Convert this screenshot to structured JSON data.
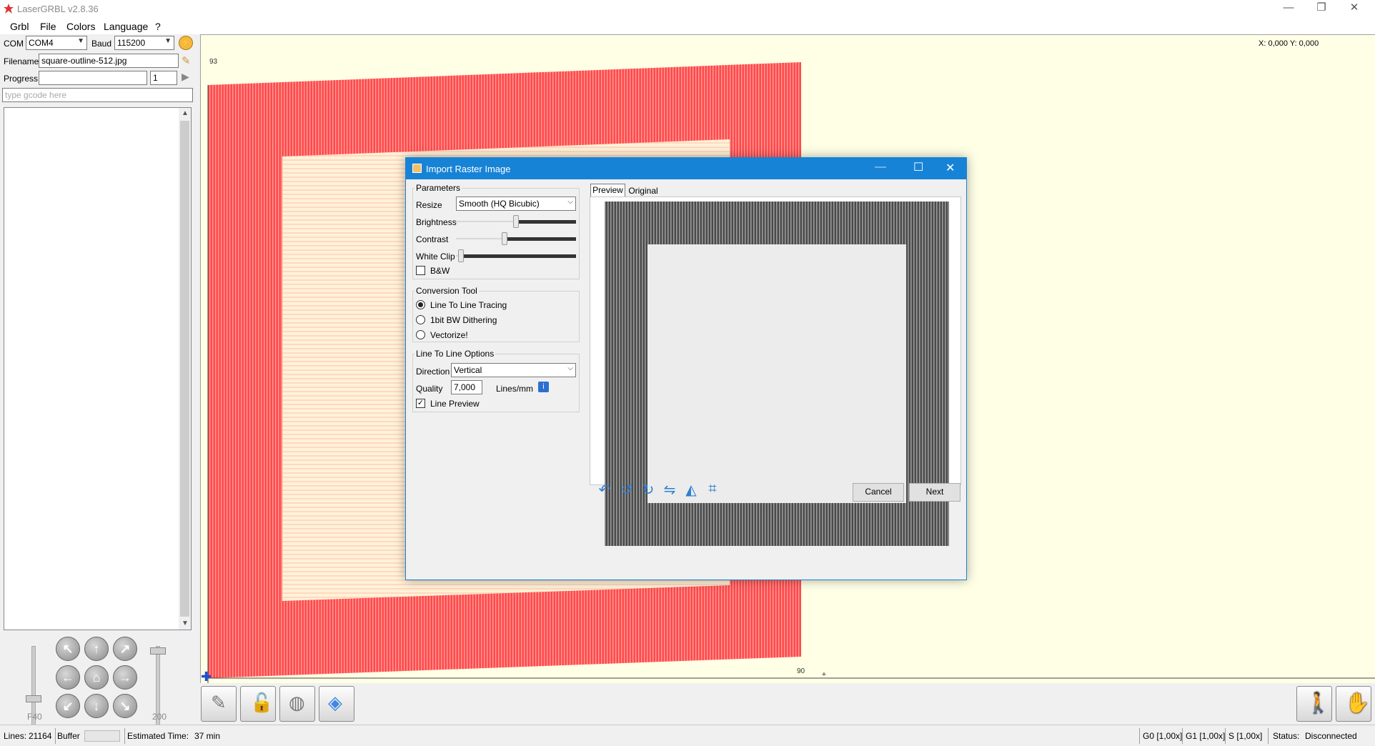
{
  "window": {
    "title": "LaserGRBL v2.8.36",
    "minimize": "—",
    "restore": "❐",
    "close": "✕"
  },
  "menu": [
    "Grbl",
    "File",
    "Colors",
    "Language",
    "?"
  ],
  "connection": {
    "com_label": "COM",
    "com_value": "COM4",
    "baud_label": "Baud",
    "baud_value": "115200"
  },
  "file": {
    "filename_label": "Filename",
    "filename_value": "square-outline-512.jpg"
  },
  "progress": {
    "label": "Progress",
    "count": "1",
    "fraction": 0
  },
  "gcode": {
    "placeholder": "type gcode here"
  },
  "jog": {
    "f_label": "F40",
    "step_label": "200"
  },
  "canvas": {
    "coords": "X: 0,000 Y: 0,000",
    "y_tick": "93",
    "x_tick": "90"
  },
  "status": {
    "lines_label": "Lines:",
    "lines_value": "21164",
    "buffer_label": "Buffer",
    "time_label": "Estimated Time:",
    "time_value": "37 min",
    "g0": "G0 [1,00x]",
    "g1": "G1 [1,00x]",
    "s": "S [1,00x]",
    "status_label": "Status:",
    "status_value": "Disconnected"
  },
  "dialog": {
    "title": "Import Raster Image",
    "parameters": {
      "label": "Parameters",
      "resize_label": "Resize",
      "resize_value": "Smooth (HQ Bicubic)",
      "brightness_label": "Brightness",
      "brightness": 0.5,
      "contrast_label": "Contrast",
      "contrast": 0.4,
      "whiteclip_label": "White Clip",
      "whiteclip": 0.02,
      "bw_label": "B&W",
      "bw": false
    },
    "conversion": {
      "label": "Conversion Tool",
      "options": [
        "Line To Line Tracing",
        "1bit BW Dithering",
        "Vectorize!"
      ],
      "selected": 0
    },
    "line_options": {
      "label": "Line To Line Options",
      "direction_label": "Direction",
      "direction_value": "Vertical",
      "quality_label": "Quality",
      "quality_value": "7,000",
      "quality_unit": "Lines/mm",
      "line_preview_label": "Line Preview",
      "line_preview": true
    },
    "tabs": [
      "Preview",
      "Original"
    ],
    "active_tab": 0,
    "cancel_label": "Cancel",
    "next_label": "Next"
  },
  "colors": {
    "accent": "#1783d7",
    "burn": "#ff3b3b",
    "canvas_bg": "#ffffe6"
  }
}
